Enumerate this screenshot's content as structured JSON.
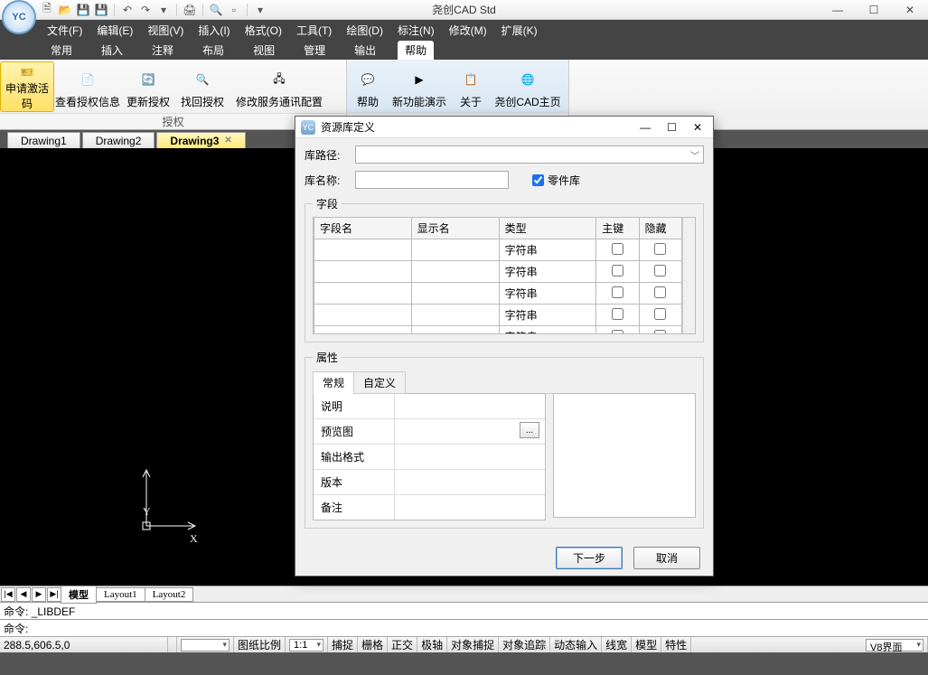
{
  "app": {
    "title": "尧创CAD Std",
    "logo_text": "YC"
  },
  "quick_access": [
    "new",
    "open",
    "save",
    "saveas",
    "|",
    "undo",
    "redo",
    "dropdown",
    "|",
    "plot",
    "|",
    "search",
    "app",
    "|",
    "down"
  ],
  "window_controls": {
    "min": "—",
    "max": "☐",
    "close": "✕"
  },
  "menu": [
    {
      "label": "文件(F)"
    },
    {
      "label": "编辑(E)"
    },
    {
      "label": "视图(V)"
    },
    {
      "label": "插入(I)"
    },
    {
      "label": "格式(O)"
    },
    {
      "label": "工具(T)"
    },
    {
      "label": "绘图(D)"
    },
    {
      "label": "标注(N)"
    },
    {
      "label": "修改(M)"
    },
    {
      "label": "扩展(K)"
    }
  ],
  "ribbon_tabs": [
    {
      "label": "常用"
    },
    {
      "label": "插入"
    },
    {
      "label": "注释"
    },
    {
      "label": "布局"
    },
    {
      "label": "视图"
    },
    {
      "label": "管理"
    },
    {
      "label": "输出"
    },
    {
      "label": "帮助",
      "active": true
    }
  ],
  "ribbon_groups": [
    {
      "label": "授权",
      "buttons": [
        {
          "label": "申请激活码",
          "icon": "🎫",
          "active": true
        },
        {
          "label": "查看授权信息",
          "icon": "📄"
        },
        {
          "label": "更新授权",
          "icon": "🔄"
        },
        {
          "label": "找回授权",
          "icon": "🔍"
        },
        {
          "label": "修改服务通讯配置",
          "icon": "🖧",
          "wide": true
        }
      ]
    },
    {
      "label": "",
      "style": "help",
      "buttons": [
        {
          "label": "帮助",
          "icon": "💬"
        },
        {
          "label": "新功能演示",
          "icon": "▶"
        },
        {
          "label": "关于",
          "icon": "📋"
        },
        {
          "label": "尧创CAD主页",
          "icon": "🌐"
        }
      ]
    }
  ],
  "doc_tabs": [
    {
      "label": "Drawing1"
    },
    {
      "label": "Drawing2"
    },
    {
      "label": "Drawing3",
      "active": true,
      "closable": true
    }
  ],
  "axis": {
    "y": "Y",
    "x": "X"
  },
  "layout_tabs": {
    "nav": [
      "|◀",
      "◀",
      "▶",
      "▶|"
    ],
    "tabs": [
      {
        "label": "模型",
        "active": true
      },
      {
        "label": "Layout1"
      },
      {
        "label": "Layout2"
      }
    ]
  },
  "command": {
    "prefix": "命令:",
    "last": "_LIBDEF",
    "prompt": "命令:"
  },
  "status": {
    "coord": "288.5,606.5,0",
    "blank": "",
    "scale_label": "图纸比例",
    "scale_value": "1:1",
    "toggles": [
      "捕捉",
      "栅格",
      "正交",
      "极轴",
      "对象捕捉",
      "对象追踪",
      "动态输入",
      "线宽",
      "模型",
      "特性"
    ],
    "right": "V8界面"
  },
  "dialog": {
    "title": "资源库定义",
    "controls": {
      "min": "—",
      "max": "☐",
      "close": "✕"
    },
    "path_label": "库路径:",
    "path_value": "",
    "name_label": "库名称:",
    "name_value": "",
    "parts_checkbox": "零件库",
    "fields_legend": "字段",
    "fields_headers": [
      "字段名",
      "显示名",
      "类型",
      "主键",
      "隐藏"
    ],
    "fields_rows": [
      {
        "name": "",
        "disp": "",
        "type": "字符串",
        "pk": false,
        "hidden": false
      },
      {
        "name": "",
        "disp": "",
        "type": "字符串",
        "pk": false,
        "hidden": false
      },
      {
        "name": "",
        "disp": "",
        "type": "字符串",
        "pk": false,
        "hidden": false
      },
      {
        "name": "",
        "disp": "",
        "type": "字符串",
        "pk": false,
        "hidden": false
      },
      {
        "name": "",
        "disp": "",
        "type": "字符串",
        "pk": false,
        "hidden": false
      }
    ],
    "attr_legend": "属性",
    "attr_tabs": [
      {
        "label": "常规",
        "active": true
      },
      {
        "label": "自定义"
      }
    ],
    "attr_rows": [
      {
        "k": "说明",
        "v": ""
      },
      {
        "k": "预览图",
        "v": "",
        "browse": true
      },
      {
        "k": "输出格式",
        "v": ""
      },
      {
        "k": "版本",
        "v": ""
      },
      {
        "k": "备注",
        "v": ""
      }
    ],
    "browse": "...",
    "next": "下一步",
    "cancel": "取消"
  }
}
